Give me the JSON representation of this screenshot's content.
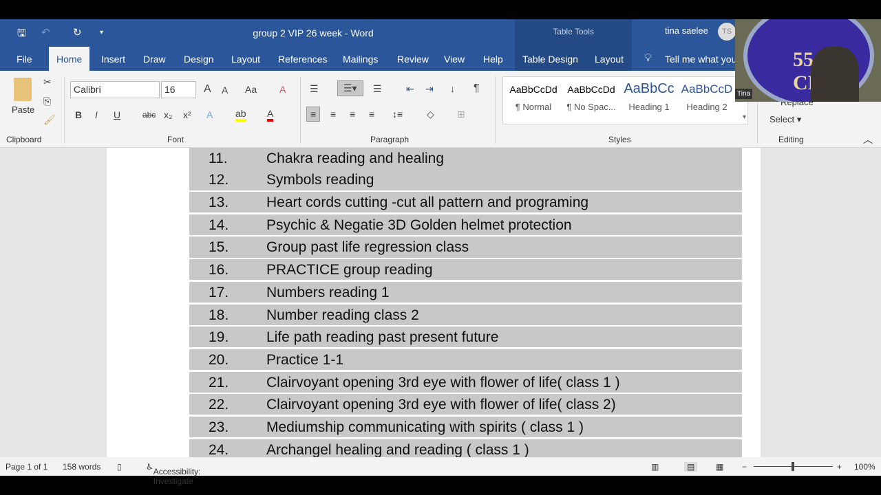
{
  "window": {
    "title": "group 2 VIP 26 week  -  Word",
    "table_tools": "Table Tools",
    "user_name": "tina saelee",
    "user_initials": "TS"
  },
  "tabs": [
    "File",
    "Home",
    "Insert",
    "Draw",
    "Design",
    "Layout",
    "References",
    "Mailings",
    "Review",
    "View",
    "Help",
    "Table Design",
    "Layout"
  ],
  "tell_me": "Tell me what you",
  "ribbon": {
    "clipboard": {
      "paste": "Paste",
      "label": "Clipboard"
    },
    "font": {
      "name": "Calibri",
      "size": "16",
      "label": "Font",
      "change_case": "Aa"
    },
    "paragraph": {
      "label": "Paragraph"
    },
    "styles": {
      "label": "Styles",
      "items": [
        {
          "sample": "AaBbCcDd",
          "name": "¶ Normal"
        },
        {
          "sample": "AaBbCcDd",
          "name": "¶ No Spac..."
        },
        {
          "sample": "AaBbCc",
          "name": "Heading 1"
        },
        {
          "sample": "AaBbCcD",
          "name": "Heading 2"
        }
      ]
    },
    "editing": {
      "replace": "Replace",
      "select": "Select",
      "label": "Editing"
    }
  },
  "document": {
    "rows": [
      {
        "num": "11.",
        "text": "Chakra reading and healing"
      },
      {
        "num": "12.",
        "text": "Symbols reading"
      },
      {
        "num": "13.",
        "text": "Heart cords cutting -cut all pattern and programing"
      },
      {
        "num": "14.",
        "text": "Psychic & Negatie 3D Golden helmet protection"
      },
      {
        "num": "15.",
        "text": "Group past life regression class"
      },
      {
        "num": "16.",
        "text": "PRACTICE group reading"
      },
      {
        "num": "17.",
        "text": "Numbers reading 1"
      },
      {
        "num": "18.",
        "text": "Number reading class 2"
      },
      {
        "num": "19.",
        "text": "Life path reading past present future"
      },
      {
        "num": "20.",
        "text": "Practice 1-1"
      },
      {
        "num": "21.",
        "text": "Clairvoyant opening 3rd eye with flower of life( class 1 )"
      },
      {
        "num": "22.",
        "text": "Clairvoyant opening 3rd eye with flower of life( class 2)"
      },
      {
        "num": "23.",
        "text": "Mediumship communicating with spirits ( class 1 )"
      },
      {
        "num": "24.",
        "text": "Archangel healing and reading ( class 1 )"
      }
    ]
  },
  "status": {
    "page": "Page 1 of 1",
    "words": "158 words",
    "accessibility": "Accessibility: Investigate",
    "zoom": "100%"
  },
  "video": {
    "participant": "Tina",
    "seal_text": "55 CM"
  }
}
